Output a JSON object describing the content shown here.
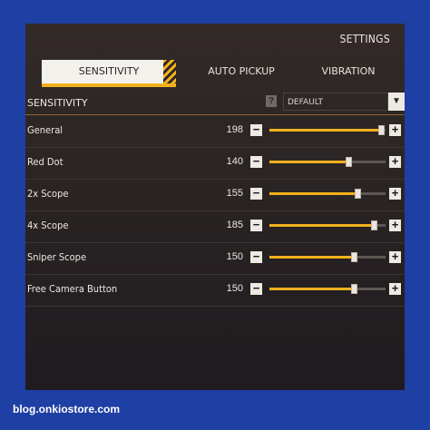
{
  "header": {
    "title": "SETTINGS"
  },
  "tabs": [
    {
      "label": "SENSITIVITY",
      "active": true
    },
    {
      "label": "AUTO PICKUP",
      "active": false
    },
    {
      "label": "VIBRATION",
      "active": false
    }
  ],
  "section": {
    "label": "SENSITIVITY",
    "help_glyph": "?",
    "preset_value": "DEFAULT",
    "preset_arrow": "▼"
  },
  "sliders": [
    {
      "label": "General",
      "value": "198",
      "fraction": 0.96
    },
    {
      "label": "Red Dot",
      "value": "140",
      "fraction": 0.68
    },
    {
      "label": "2x Scope",
      "value": "155",
      "fraction": 0.76
    },
    {
      "label": "4x Scope",
      "value": "185",
      "fraction": 0.9
    },
    {
      "label": "Sniper Scope",
      "value": "150",
      "fraction": 0.73
    },
    {
      "label": "Free Camera Button",
      "value": "150",
      "fraction": 0.73
    }
  ],
  "controls": {
    "minus": "−",
    "plus": "+"
  },
  "footer": {
    "site": "blog.onkiostore.com"
  },
  "colors": {
    "accent": "#f2b01e",
    "frame": "#1e3fa3",
    "panel": "#2a2424"
  }
}
